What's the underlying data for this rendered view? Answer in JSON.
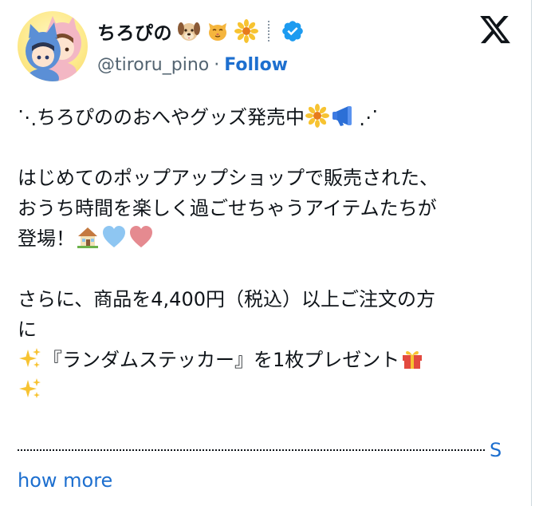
{
  "account": {
    "display_name": "ちろぴの",
    "handle": "@tiroru_pino",
    "separator": "·",
    "follow_label": "Follow",
    "name_emojis": [
      "dog-face-icon",
      "cat-face-icon",
      "blossom-icon"
    ],
    "verified": true
  },
  "tweet": {
    "line1": "⋱ちろぴののおへやグッズ発売中",
    "line1_tail": "⋰",
    "line2": "はじめてのポップアップショップで販売された、",
    "line3": "おうち時間を楽しく過ごせちゃうアイテムたちが",
    "line4": "登場！",
    "line5": "さらに、商品を4,400円（税込）以上ご注文の方",
    "line6": "に",
    "line7": "『ランダムステッカー』を1枚プレゼント"
  },
  "show_more": {
    "part1": "S",
    "part2": "how more"
  },
  "colors": {
    "link": "#1d6fcf",
    "verified": "#1d9bf0",
    "text": "#0f1419",
    "muted": "#536471"
  }
}
